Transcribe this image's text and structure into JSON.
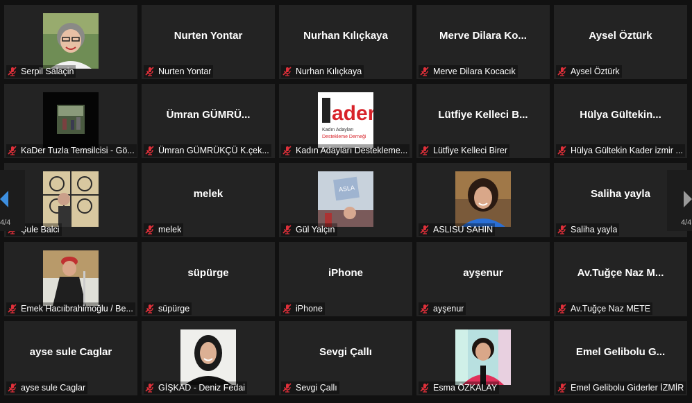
{
  "pager": {
    "left_count": "4/4",
    "right_count": "4/4"
  },
  "participants": [
    {
      "name": "Serpil Salaçin",
      "display": "",
      "photo": "portrait-gray-hair"
    },
    {
      "name": "Nurten Yontar",
      "display": "Nurten Yontar",
      "photo": ""
    },
    {
      "name": "Nurhan Kılıçkaya",
      "display": "Nurhan Kılıçkaya",
      "photo": ""
    },
    {
      "name": "Merve Dilara Kocacık",
      "display": "Merve Dilara Ko...",
      "photo": ""
    },
    {
      "name": "Aysel Öztürk",
      "display": "Aysel Öztürk",
      "photo": ""
    },
    {
      "name": "KaDer Tuzla Temsilcisi - Gö...",
      "display": "",
      "photo": "dark-scene"
    },
    {
      "name": "Ümran GÜMRÜKÇÜ  K.çek...",
      "display": "Ümran GÜMRÜ...",
      "photo": ""
    },
    {
      "name": "Kadın Adayları Destekleme...",
      "display": "",
      "photo": "kader-logo"
    },
    {
      "name": "Lütfiye Kelleci Birer",
      "display": "Lütfiye Kelleci B...",
      "photo": ""
    },
    {
      "name": "Hülya Gültekin Kader izmir ...",
      "display": "Hülya  Gültekin...",
      "photo": ""
    },
    {
      "name": "Şule Balci",
      "display": "",
      "photo": "ornate-gate"
    },
    {
      "name": "melek",
      "display": "melek",
      "photo": ""
    },
    {
      "name": "Gül Yalçın",
      "display": "",
      "photo": "protest-sign"
    },
    {
      "name": "ASLISU SAHIN",
      "display": "",
      "photo": "portrait-curly-hair"
    },
    {
      "name": "Saliha yayla",
      "display": "Saliha yayla",
      "photo": ""
    },
    {
      "name": "Emek Hacıibrahimoğlu / Be...",
      "display": "",
      "photo": "portrait-red-hat"
    },
    {
      "name": "süpürge",
      "display": "süpürge",
      "photo": ""
    },
    {
      "name": "iPhone",
      "display": "iPhone",
      "photo": ""
    },
    {
      "name": "ayşenur",
      "display": "ayşenur",
      "photo": ""
    },
    {
      "name": "Av.Tuğçe Naz METE",
      "display": "Av.Tuğçe Naz M...",
      "photo": ""
    },
    {
      "name": "ayse sule Caglar",
      "display": "ayse sule Caglar",
      "photo": ""
    },
    {
      "name": "GİŞKAD - Deniz Fedai",
      "display": "",
      "photo": "portrait-dark-hair"
    },
    {
      "name": "Sevgi Çallı",
      "display": "Sevgi Çallı",
      "photo": ""
    },
    {
      "name": "Esma ÖZKALAY",
      "display": "",
      "photo": "portrait-pink-jacket"
    },
    {
      "name": "Emel Gelibolu Giderler İZMİR",
      "display": "Emel Gelibolu G...",
      "photo": ""
    }
  ],
  "logo_text": {
    "line1": "Kadın Adayları",
    "line2": "Destekleme Derneği"
  },
  "colors": {
    "tile_bg": "#232323",
    "page_bg": "#111111",
    "mic_muted": "#e0303a",
    "pager_arrow": "#3d8fe0"
  }
}
